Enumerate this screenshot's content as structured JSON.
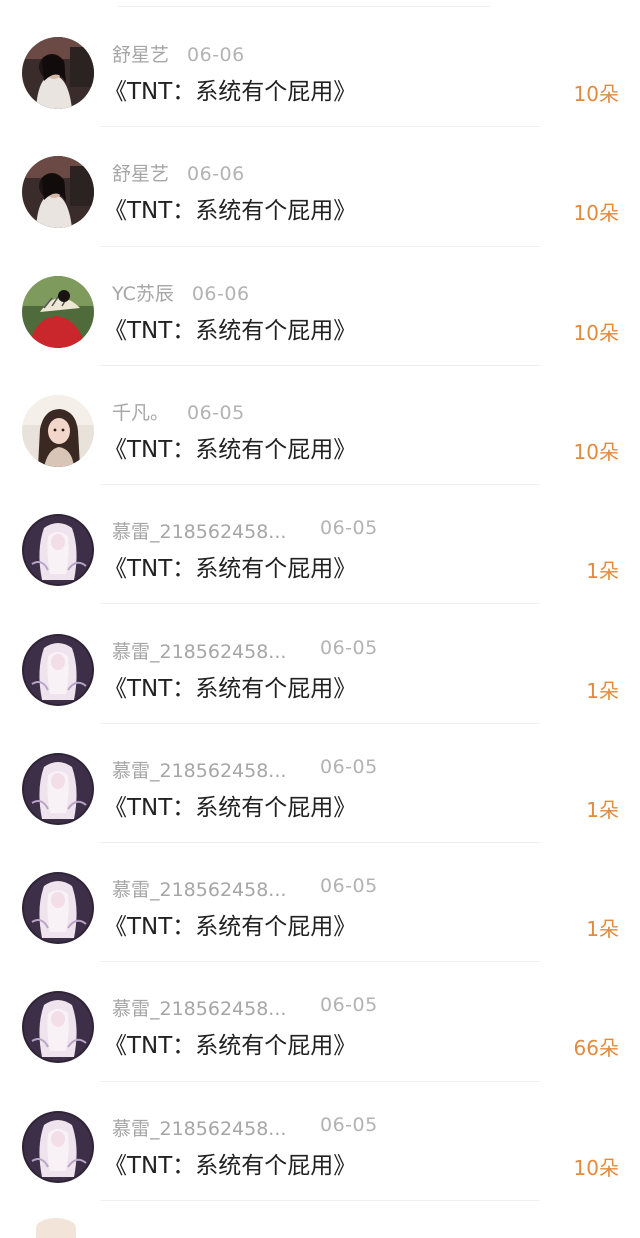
{
  "items": [
    {
      "name": "舒星艺",
      "date": "06-06",
      "title": "《TNT：系统有个屁用》",
      "amount": "10朵",
      "avatar": "girl-dark"
    },
    {
      "name": "舒星艺",
      "date": "06-06",
      "title": "《TNT：系统有个屁用》",
      "amount": "10朵",
      "avatar": "girl-dark"
    },
    {
      "name": "YC苏辰",
      "date": "06-06",
      "title": "《TNT：系统有个屁用》",
      "amount": "10朵",
      "avatar": "fan-red"
    },
    {
      "name": "千凡。",
      "date": "06-05",
      "title": "《TNT：系统有个屁用》",
      "amount": "10朵",
      "avatar": "girl-light"
    },
    {
      "name": "慕雷_218562458...",
      "date": "06-05",
      "title": "《TNT：系统有个屁用》",
      "amount": "1朵",
      "avatar": "anime-purple"
    },
    {
      "name": "慕雷_218562458...",
      "date": "06-05",
      "title": "《TNT：系统有个屁用》",
      "amount": "1朵",
      "avatar": "anime-purple"
    },
    {
      "name": "慕雷_218562458...",
      "date": "06-05",
      "title": "《TNT：系统有个屁用》",
      "amount": "1朵",
      "avatar": "anime-purple"
    },
    {
      "name": "慕雷_218562458...",
      "date": "06-05",
      "title": "《TNT：系统有个屁用》",
      "amount": "1朵",
      "avatar": "anime-purple"
    },
    {
      "name": "慕雷_218562458...",
      "date": "06-05",
      "title": "《TNT：系统有个屁用》",
      "amount": "66朵",
      "avatar": "anime-purple"
    },
    {
      "name": "慕雷_218562458...",
      "date": "06-05",
      "title": "《TNT：系统有个屁用》",
      "amount": "10朵",
      "avatar": "anime-purple"
    }
  ],
  "colors": {
    "amount": "#e28a3e",
    "title": "#222222",
    "meta": "#a6a6a6"
  }
}
